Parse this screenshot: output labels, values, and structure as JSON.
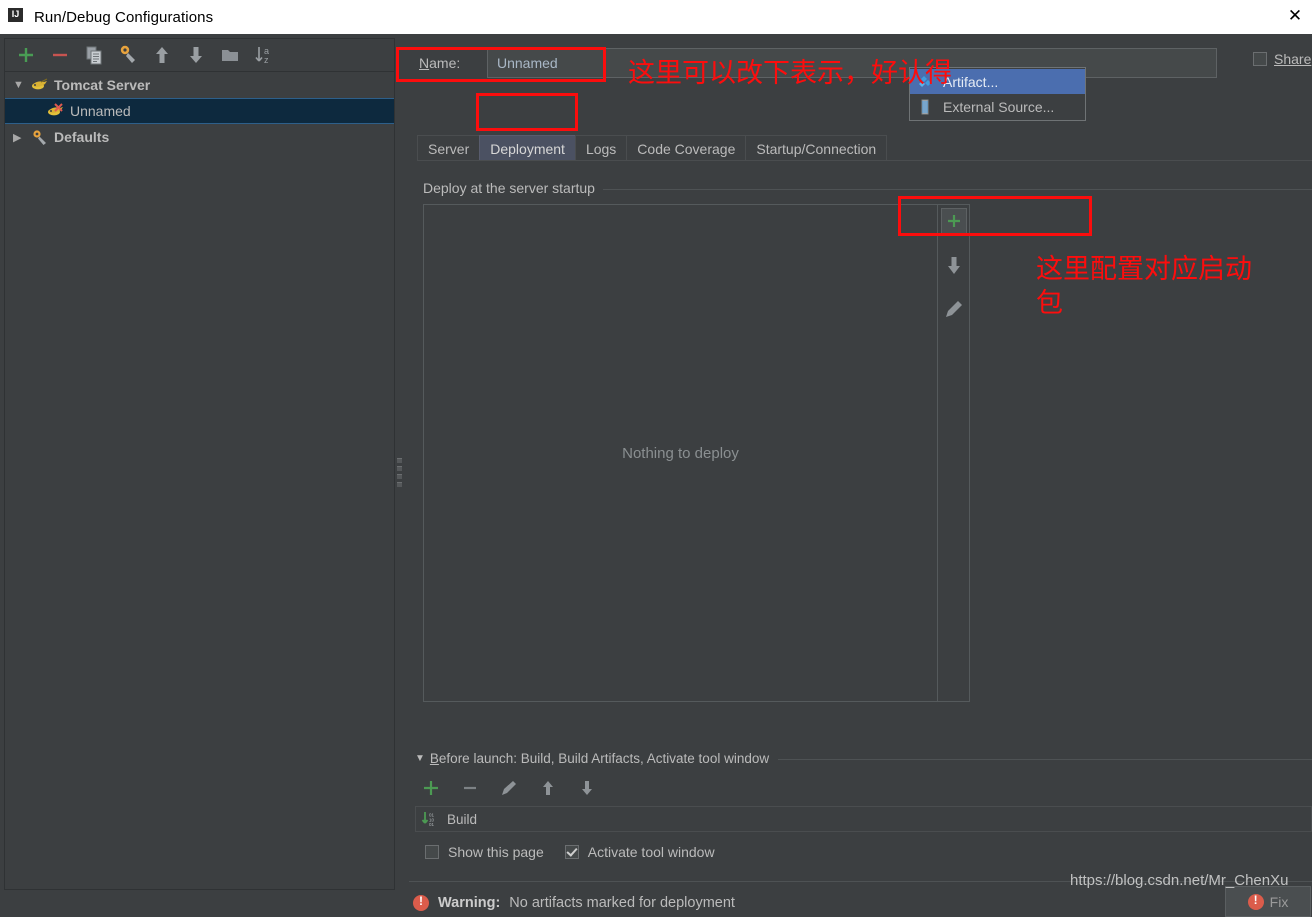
{
  "window": {
    "title": "Run/Debug Configurations",
    "app_icon": "intellij-idea-logo",
    "close_glyph": "✕"
  },
  "left_panel": {
    "toolbar": [
      {
        "name": "add-button",
        "glyph": "+"
      },
      {
        "name": "remove-button",
        "glyph": "−"
      },
      {
        "name": "copy-configuration-button",
        "glyph": "❐"
      },
      {
        "name": "edit-defaults-button",
        "glyph": "⚙"
      },
      {
        "name": "move-up-button",
        "glyph": "↑"
      },
      {
        "name": "move-down-button",
        "glyph": "↓"
      },
      {
        "name": "new-folder-button",
        "glyph": "▭"
      },
      {
        "name": "sort-alphabetically-button",
        "glyph": "↓az"
      }
    ],
    "tree": [
      {
        "label": "Tomcat Server",
        "twisty": "▼",
        "icon": "tomcat-icon",
        "level": 0,
        "selected": false,
        "bold": true
      },
      {
        "label": "Unnamed",
        "twisty": "",
        "icon": "tomcat-error-icon",
        "level": 1,
        "selected": true,
        "bold": false
      },
      {
        "label": "Defaults",
        "twisty": "▶",
        "icon": "gear-wrench-icon",
        "level": 0,
        "selected": false,
        "bold": true
      }
    ]
  },
  "right_panel": {
    "name_label": "Name:",
    "name_label_mnemonic": "N",
    "name_value": "Unnamed",
    "share_label": "Share",
    "share_checked": false,
    "tabs": [
      {
        "label": "Server",
        "active": false
      },
      {
        "label": "Deployment",
        "active": true
      },
      {
        "label": "Logs",
        "active": false
      },
      {
        "label": "Code Coverage",
        "active": false
      },
      {
        "label": "Startup/Connection",
        "active": false
      }
    ],
    "deploy_group_title": "Deploy at the server startup",
    "deploy_empty_text": "Nothing to deploy",
    "deploy_sidebar": [
      {
        "name": "add-deployment-button",
        "glyph": "+",
        "pressed": true
      },
      {
        "name": "move-down-button",
        "glyph": "⬇",
        "pressed": false
      },
      {
        "name": "edit-button",
        "glyph": "✎",
        "pressed": false
      }
    ],
    "popup_menu": [
      {
        "label": "Artifact...",
        "icon": "artifact-icon",
        "highlighted": true
      },
      {
        "label": "External Source...",
        "icon": "external-source-icon",
        "highlighted": false
      }
    ],
    "before_launch": {
      "title": "Before launch: Build, Build Artifacts, Activate tool window",
      "title_mnemonic": "B",
      "twisty": "▼",
      "toolbar": [
        {
          "name": "add-task-button",
          "glyph": "+"
        },
        {
          "name": "remove-task-button",
          "glyph": "−"
        },
        {
          "name": "edit-task-button",
          "glyph": "✎"
        },
        {
          "name": "move-task-up-button",
          "glyph": "↑"
        },
        {
          "name": "move-task-down-button",
          "glyph": "↓"
        }
      ],
      "tasks": [
        {
          "label": "Build",
          "icon": "build-icon"
        }
      ],
      "show_this_page_label": "Show this page",
      "show_this_page_checked": false,
      "activate_tool_window_label": "Activate tool window",
      "activate_tool_window_checked": true
    },
    "warning": {
      "prefix": "Warning:",
      "message": "No artifacts marked for deployment",
      "fix_label": "Fix",
      "icon": "warning-icon"
    }
  },
  "annotations": {
    "name_note": "这里可以改下表示，好认得",
    "artifact_note": "这里配置对应启动\n包"
  },
  "watermark": "https://blog.csdn.net/Mr_ChenXu",
  "colors": {
    "dialog_bg": "#3c3f41",
    "field_bg": "#45494a",
    "selection_blue": "#4b6eaf",
    "tree_selection": "#0d293e",
    "active_tab": "#4b5162",
    "annotation_red": "#fd0d0d",
    "warning_red": "#db5c4b",
    "add_green": "#499c54",
    "text": "#bbbbbb"
  }
}
